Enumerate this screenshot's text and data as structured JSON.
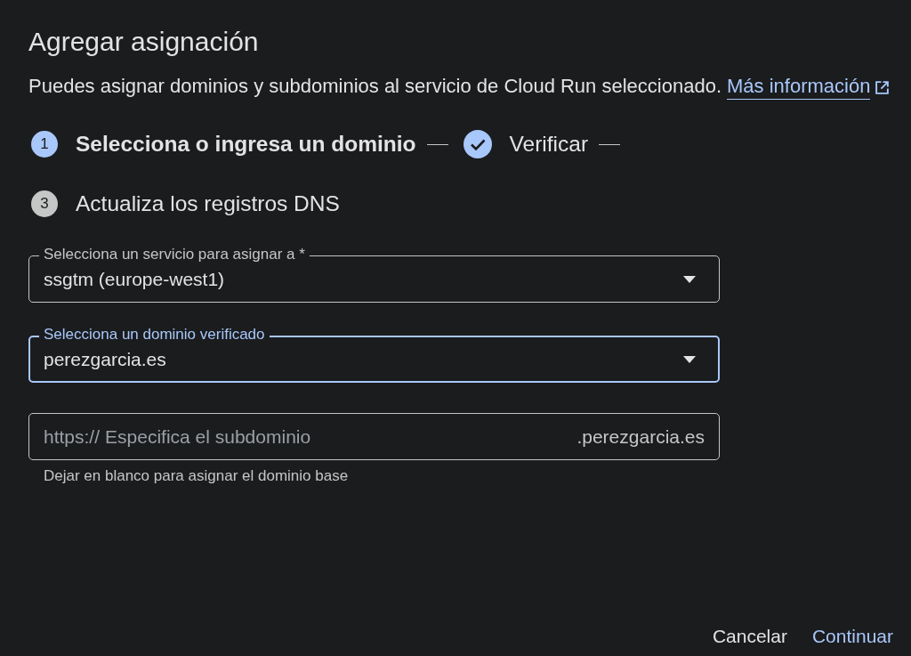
{
  "dialog": {
    "title": "Agregar asignación",
    "description": "Puedes asignar dominios y subdominios al servicio de Cloud Run seleccionado.",
    "link": "Más información"
  },
  "steps": [
    {
      "number": "1",
      "label": "Selecciona o ingresa un dominio",
      "kind": "active"
    },
    {
      "label": "Verificar",
      "kind": "complete"
    },
    {
      "number": "3",
      "label": "Actualiza los registros DNS",
      "kind": "pending"
    }
  ],
  "fields": [
    {
      "kind": "select",
      "label": "Selecciona un servicio para asignar a *",
      "value": "ssgtm (europe-west1)",
      "focused": false
    },
    {
      "kind": "select",
      "label": "Selecciona un dominio verificado",
      "value": "perezgarcia.es",
      "focused": true
    },
    {
      "kind": "text",
      "prefix": "https://",
      "placeholder": "Especifica el subdominio",
      "suffix": ".perezgarcia.es",
      "helper": "Dejar en blanco para asignar el dominio base",
      "focused": false
    }
  ],
  "buttons": [
    {
      "label": "Cancelar",
      "kind": "secondary"
    },
    {
      "label": "Continuar",
      "kind": "primary"
    }
  ]
}
